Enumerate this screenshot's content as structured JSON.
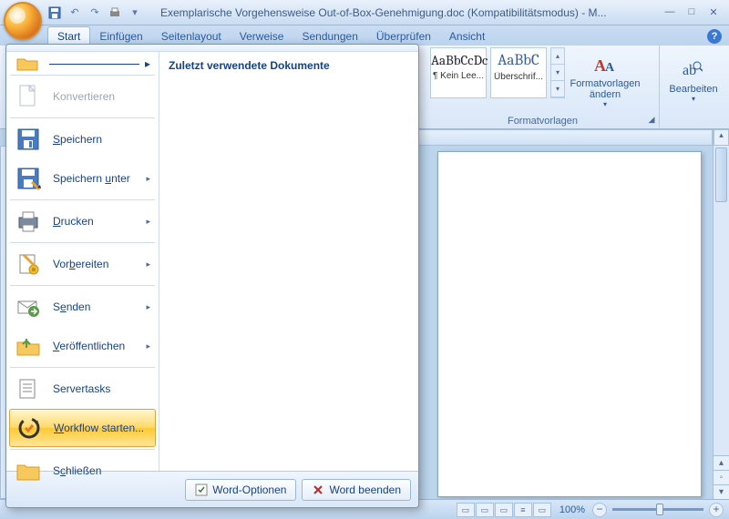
{
  "title_text": "Exemplarische Vorgehensweise Out-of-Box-Genehmigung.doc (Kompatibilitätsmodus) - M...",
  "tabs": {
    "start": "Start",
    "einfuegen": "Einfügen",
    "seitenlayout": "Seitenlayout",
    "verweise": "Verweise",
    "sendungen": "Sendungen",
    "ueberpruefen": "Überprüfen",
    "ansicht": "Ansicht"
  },
  "ribbon": {
    "styles_group_label": "Formatvorlagen",
    "style1_preview": "AaBbCcDc",
    "style1_name": "¶ Kein Lee...",
    "style2_preview": "AaBbC",
    "style2_name": "Überschrif...",
    "change_styles": "Formatvorlagen ändern",
    "bearbeiten_label": "Bearbeiten"
  },
  "office_menu": {
    "recent_docs_header": "Zuletzt verwendete Dokumente",
    "items": {
      "konvertieren": "Konvertieren",
      "speichern": "Speichern",
      "speichern_unter": "Speichern unter",
      "drucken": "Drucken",
      "vorbereiten": "Vorbereiten",
      "senden": "Senden",
      "veroeffentlichen": "Veröffentlichen",
      "servertasks": "Servertasks",
      "workflow": "Workflow starten...",
      "schliessen": "Schließen"
    },
    "footer": {
      "optionen": "Word-Optionen",
      "beenden": "Word beenden"
    }
  },
  "status": {
    "zoom_pct": "100%"
  }
}
